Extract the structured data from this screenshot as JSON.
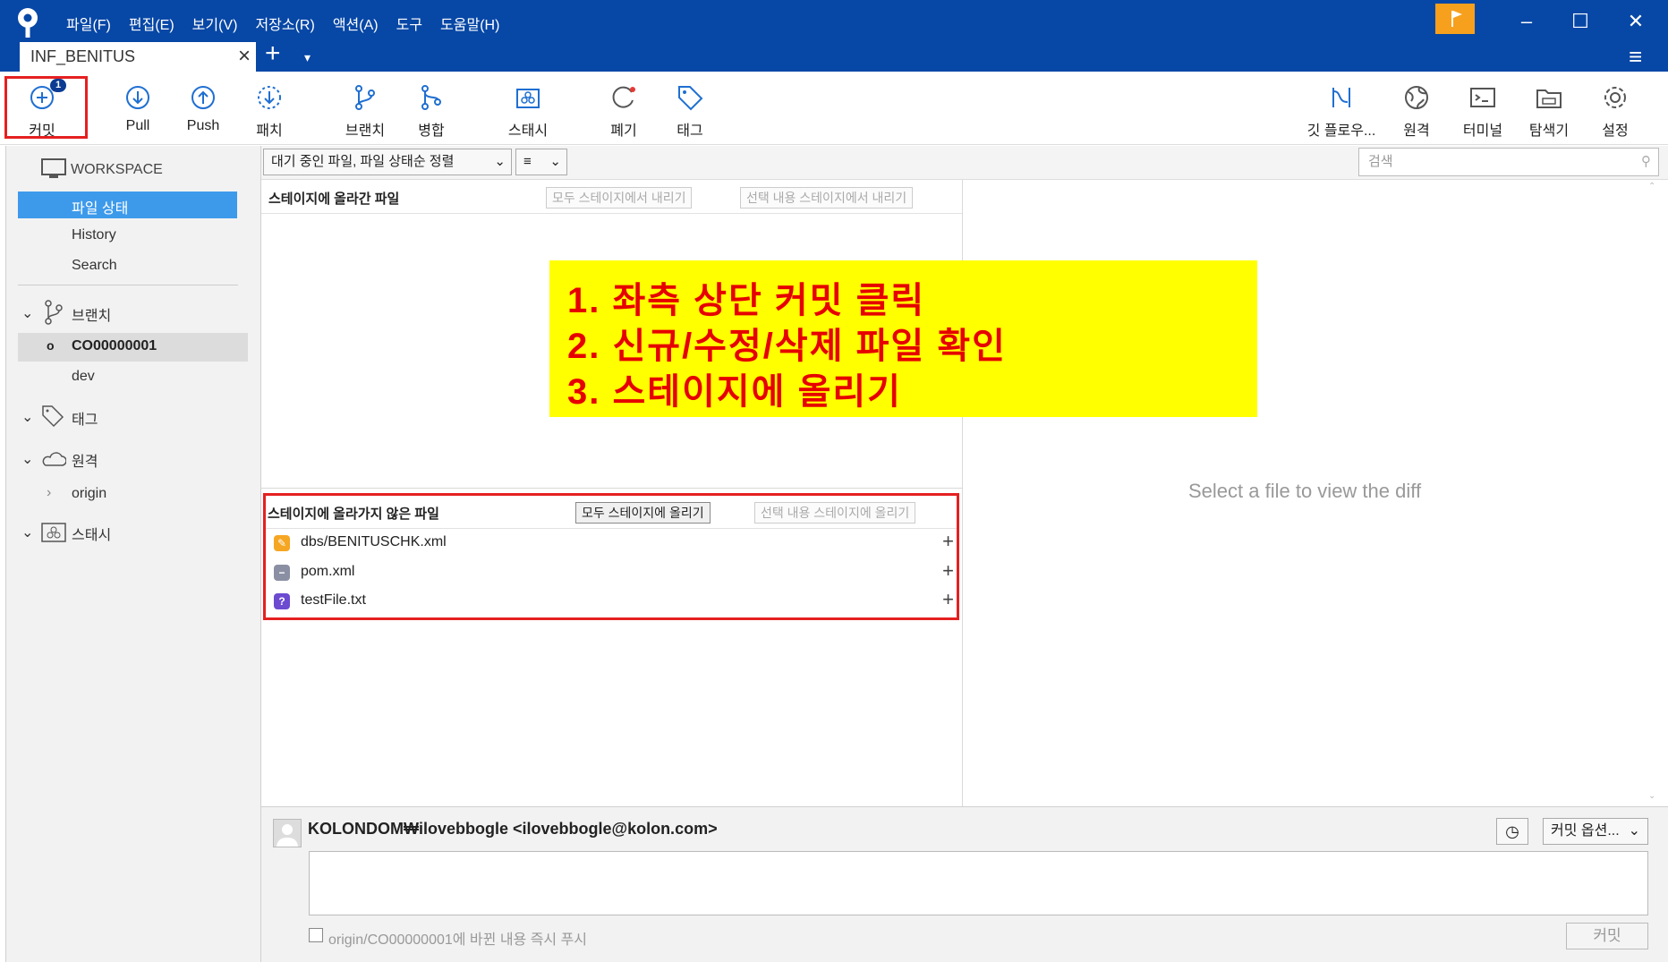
{
  "menu": [
    "파일(F)",
    "편집(E)",
    "보기(V)",
    "저장소(R)",
    "액션(A)",
    "도구",
    "도움말(H)"
  ],
  "tab": {
    "name": "INF_BENITUS"
  },
  "toolbar": {
    "commit": "커밋",
    "commit_badge": "1",
    "pull": "Pull",
    "push": "Push",
    "patch": "패치",
    "branch": "브랜치",
    "merge": "병합",
    "stash": "스태시",
    "discard": "폐기",
    "tag": "태그",
    "gitflow": "깃 플로우...",
    "remote": "원격",
    "terminal": "터미널",
    "explorer": "탐색기",
    "settings": "설정"
  },
  "sidebar": {
    "workspace": "WORKSPACE",
    "file_status": "파일 상태",
    "history": "History",
    "search": "Search",
    "branches": "브랜치",
    "current_branch": "CO00000001",
    "branch_dev": "dev",
    "tags": "태그",
    "remotes": "원격",
    "remote_origin": "origin",
    "stashes": "스태시"
  },
  "filter": {
    "sort": "대기 중인 파일, 파일 상태순 정렬",
    "view": "≡"
  },
  "search": {
    "placeholder": "검색"
  },
  "staged": {
    "title": "스테이지에 올라간 파일",
    "unstage_all": "모두 스테이지에서 내리기",
    "unstage_sel": "선택 내용 스테이지에서 내리기"
  },
  "unstaged": {
    "title": "스테이지에 올라가지 않은 파일",
    "stage_all": "모두 스테이지에 올리기",
    "stage_sel": "선택 내용 스테이지에 올리기",
    "files": [
      {
        "name": "dbs/BENITUSCHK.xml",
        "status": "modified",
        "color": "#f5a623"
      },
      {
        "name": "pom.xml",
        "status": "removed",
        "color": "#8b8fa3"
      },
      {
        "name": "testFile.txt",
        "status": "untracked",
        "color": "#6c4bd1"
      }
    ]
  },
  "annotation": {
    "line1": "1.  좌측 상단 커밋 클릭",
    "line2": "2.  신규/수정/삭제 파일 확인",
    "line3": "3.  스테이지에 올리기"
  },
  "diff": {
    "empty": "Select a file to view the diff"
  },
  "commit": {
    "author": "KOLONDOM₩ilovebbogle <ilovebbogle@kolon.com>",
    "options": "커밋 옵션...",
    "push_label": "origin/CO00000001에 바뀐 내용 즉시 푸시",
    "button": "커밋"
  }
}
